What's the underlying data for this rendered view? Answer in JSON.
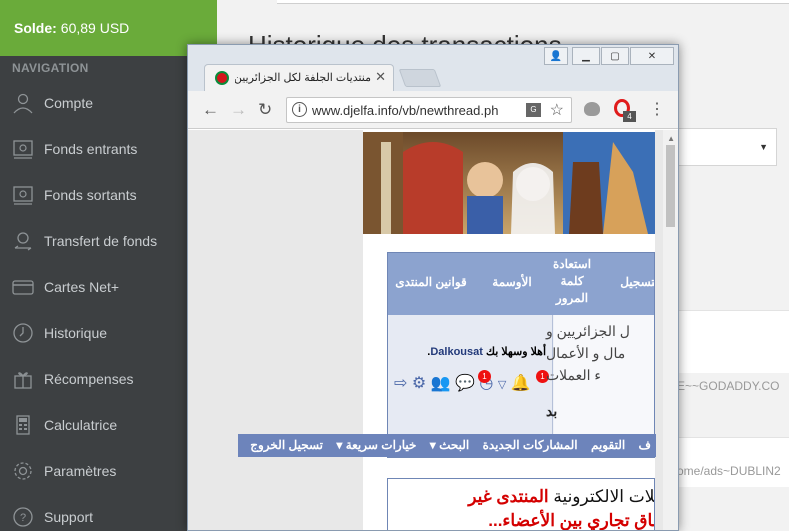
{
  "sidebar": {
    "balance_label": "Solde:",
    "balance_value": "60,89 USD",
    "nav_title": "NAVIGATION",
    "items": [
      {
        "label": "Compte",
        "icon": "user-icon"
      },
      {
        "label": "Fonds entrants",
        "icon": "inbox-icon"
      },
      {
        "label": "Fonds sortants",
        "icon": "outbox-icon"
      },
      {
        "label": "Transfert de fonds",
        "icon": "transfer-icon"
      },
      {
        "label": "Cartes Net+",
        "icon": "card-icon"
      },
      {
        "label": "Historique",
        "icon": "history-icon"
      },
      {
        "label": "Récompenses",
        "icon": "gift-icon"
      },
      {
        "label": "Calculatrice",
        "icon": "calculator-icon"
      },
      {
        "label": "Paramètres",
        "icon": "gear-icon"
      },
      {
        "label": "Support",
        "icon": "help-icon"
      }
    ]
  },
  "main": {
    "title": "Historique des transactions",
    "rows": [
      "E~~GODADDY.CO",
      "ome/ads~DUBLIN2"
    ]
  },
  "browser": {
    "tab_title": "منتديات الجلفة لكل الجزائريين و",
    "url": "www.djelfa.info/vb/newthread.ph",
    "extension_badge": "4"
  },
  "forum": {
    "header": {
      "rules": "قوانين المنتدى",
      "medals": "الأوسمة",
      "recover_password": "استعادة كلمة المرور",
      "register": "التسجيل"
    },
    "greeting_prefix": "أهلا وسهلا بك",
    "username": "Dalkousat",
    "notification_counts": [
      "1",
      "1"
    ],
    "welcome_lines": [
      "ل الجزائريين و",
      "مال و الأعمال",
      "ء العملات",
      "بد"
    ],
    "navbar": [
      "ف",
      "التقويم",
      "المشاركات الجديدة",
      "البحث",
      "خيارات سريعة",
      "تسجيل الخروج"
    ],
    "notice_line1_normal": "ملات الالكترونية",
    "notice_line1_red": "المنتدى غير",
    "notice_line2": "تفاق تجاري بين الأعضاء..."
  },
  "colors": {
    "sidebar_bg": "#3d4042",
    "balance_bg": "#6aab3a",
    "forum_header": "#8ca3cf",
    "forum_navbar": "#6d84bb",
    "notice_red": "#d40000"
  }
}
